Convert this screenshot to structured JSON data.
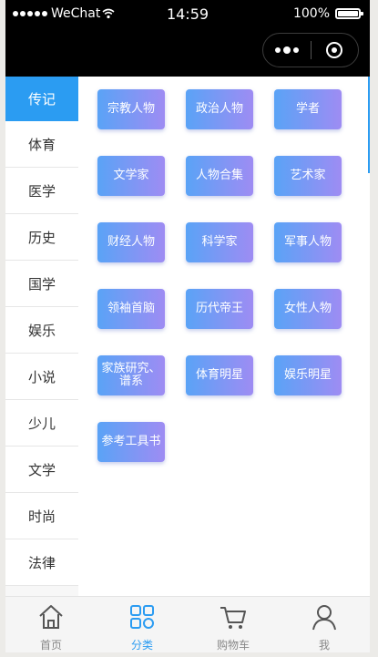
{
  "status": {
    "carrier": "WeChat",
    "time": "14:59",
    "battery": "100%"
  },
  "sidebar": {
    "items": [
      {
        "label": "传记",
        "active": true
      },
      {
        "label": "体育",
        "active": false
      },
      {
        "label": "医学",
        "active": false
      },
      {
        "label": "历史",
        "active": false
      },
      {
        "label": "国学",
        "active": false
      },
      {
        "label": "娱乐",
        "active": false
      },
      {
        "label": "小说",
        "active": false
      },
      {
        "label": "少儿",
        "active": false
      },
      {
        "label": "文学",
        "active": false
      },
      {
        "label": "时尚",
        "active": false
      },
      {
        "label": "法律",
        "active": false
      }
    ]
  },
  "categories": [
    "宗教人物",
    "政治人物",
    "学者",
    "文学家",
    "人物合集",
    "艺术家",
    "财经人物",
    "科学家",
    "军事人物",
    "领袖首脑",
    "历代帝王",
    "女性人物",
    "家族研究、谱系",
    "体育明星",
    "娱乐明星",
    "参考工具书"
  ],
  "tabbar": {
    "items": [
      {
        "label": "首页",
        "icon": "home-icon",
        "active": false
      },
      {
        "label": "分类",
        "icon": "category-icon",
        "active": true
      },
      {
        "label": "购物车",
        "icon": "cart-icon",
        "active": false
      },
      {
        "label": "我",
        "icon": "user-icon",
        "active": false
      }
    ]
  },
  "colors": {
    "accent": "#2b9cf2",
    "tag_gradient_start": "#5aa3f6",
    "tag_gradient_end": "#9e8cf3"
  }
}
